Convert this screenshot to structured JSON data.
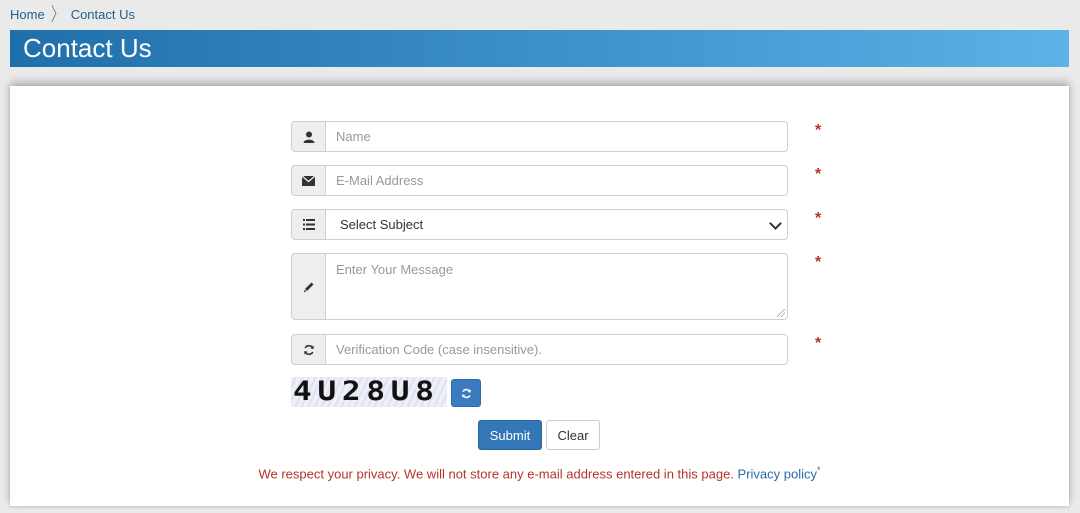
{
  "breadcrumb": {
    "home": "Home",
    "current": "Contact Us"
  },
  "page_title": "Contact Us",
  "form": {
    "name_placeholder": "Name",
    "email_placeholder": "E-Mail Address",
    "subject_selected": "Select Subject",
    "message_placeholder": "Enter Your Message",
    "verification_placeholder": "Verification Code (case insensitive).",
    "required_marker": "*",
    "captcha_text": "4U28U8",
    "submit_label": "Submit",
    "clear_label": "Clear"
  },
  "privacy": {
    "text": "We respect your privacy. We will not store any e-mail address entered in this page.",
    "link": "Privacy policy",
    "marker": "*"
  },
  "icons": {
    "name": "user-icon",
    "email": "envelope-icon",
    "subject": "list-icon",
    "message": "pencil-icon",
    "verification": "refresh-icon",
    "captcha_refresh": "refresh-icon"
  },
  "colors": {
    "banner_start": "#1f6faa",
    "banner_end": "#5bb3e6",
    "required": "#b3342a",
    "primary_button": "#3477b8",
    "link": "#2b6aa8"
  }
}
